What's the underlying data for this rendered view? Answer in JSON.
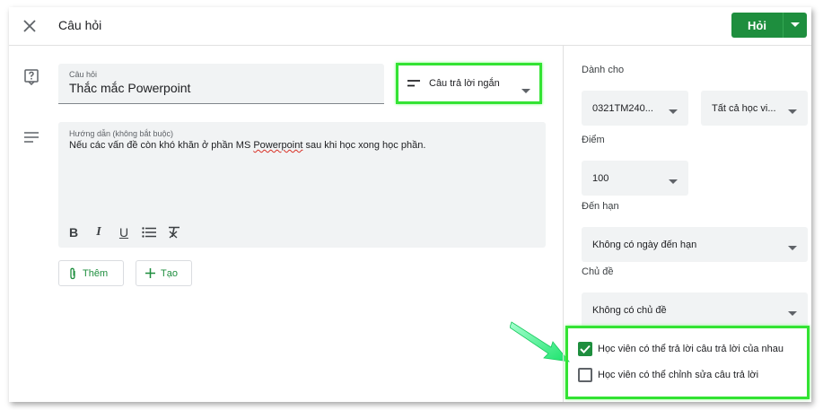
{
  "header": {
    "title": "Câu hỏi",
    "ask_label": "Hỏi"
  },
  "question": {
    "label": "Câu hỏi",
    "value": "Thắc mắc Powerpoint",
    "type_label": "Câu trả lời ngắn"
  },
  "description": {
    "label": "Hướng dẫn (không bắt buộc)",
    "value_before": "Nếu các vấn đề còn khó khăn ở phần MS ",
    "value_misspelled": "Powerpoint",
    "value_after": " sau khi học xong học phần."
  },
  "format_toolbar": {
    "bold": "B",
    "italic": "I",
    "underline": "U"
  },
  "actions": {
    "attach_label": "Thêm",
    "create_label": "Tạo"
  },
  "sidebar": {
    "for_label": "Dành cho",
    "class_value": "0321TM240...",
    "students_value": "Tất cả học vi...",
    "points_label": "Điểm",
    "points_value": "100",
    "due_label": "Đến hạn",
    "due_value": "Không có ngày đến hạn",
    "topic_label": "Chủ đề",
    "topic_value": "Không có chủ đề",
    "options": [
      {
        "label": "Học viên có thể trả lời câu trả lời của nhau",
        "checked": true
      },
      {
        "label": "Học viên có thể chỉnh sửa câu trả lời",
        "checked": false
      }
    ]
  },
  "colors": {
    "accent": "#1e8e3e",
    "highlight": "#33e333"
  }
}
